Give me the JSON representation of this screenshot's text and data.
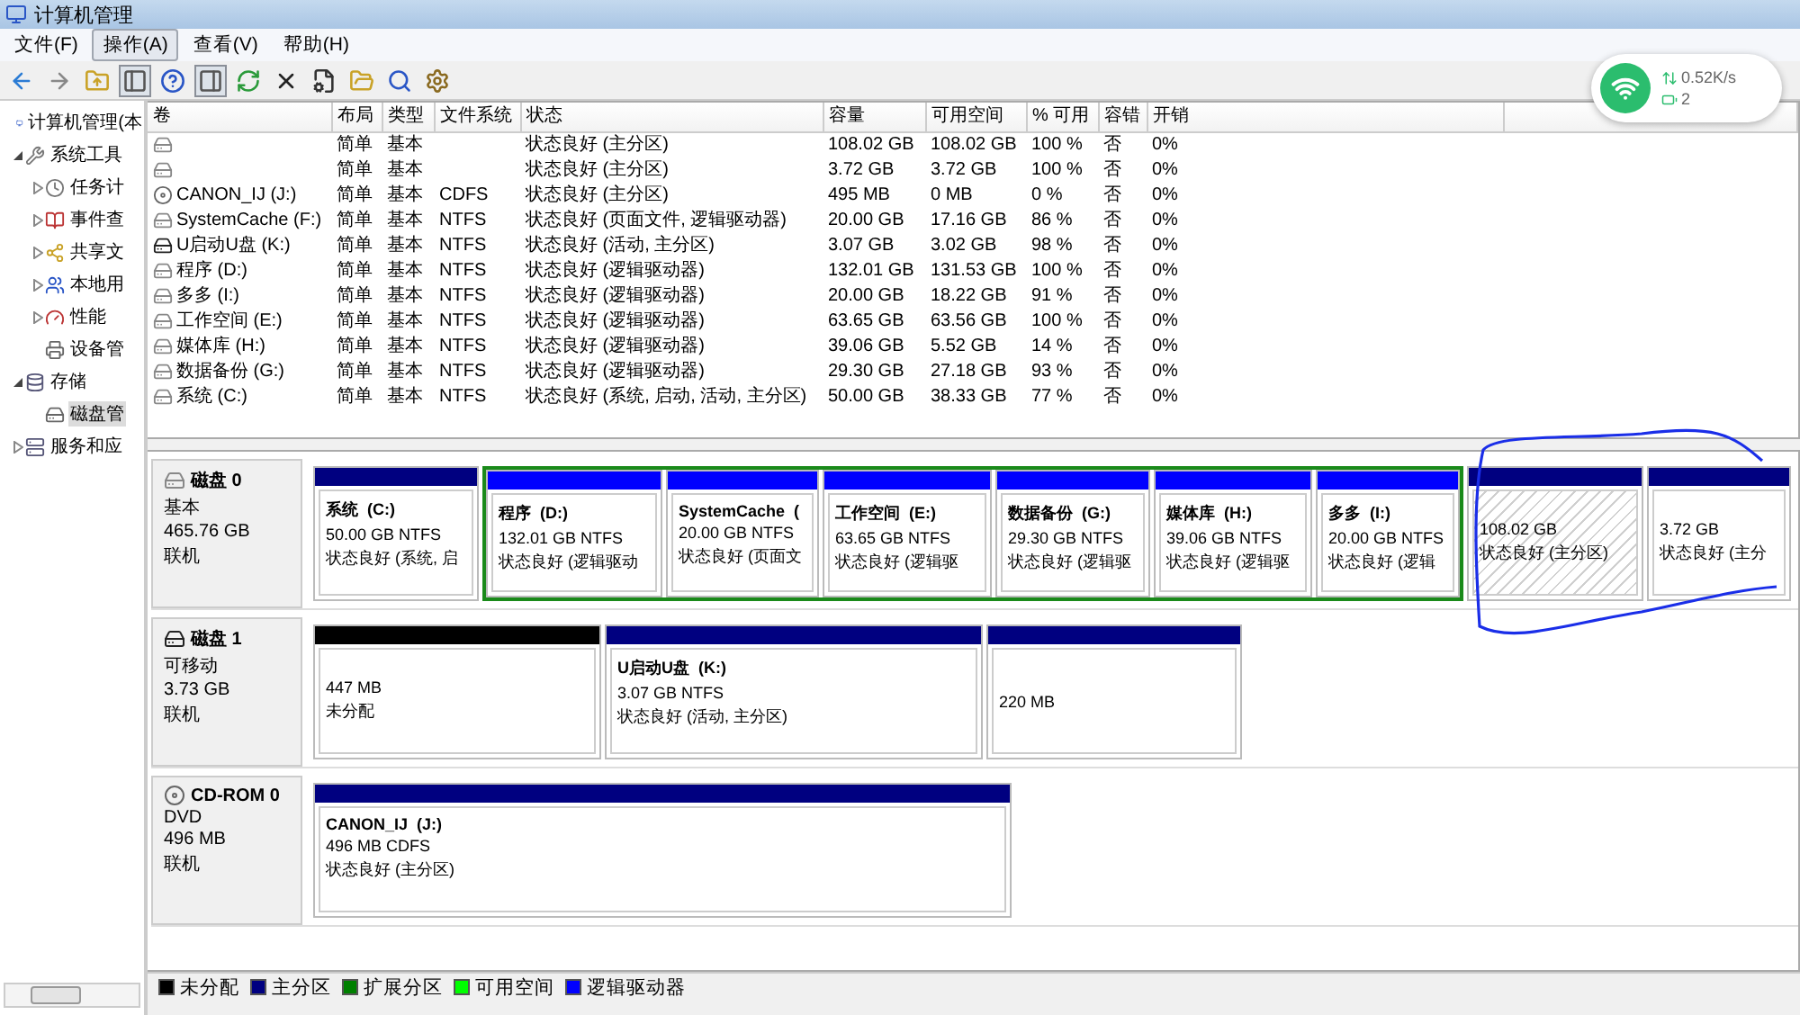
{
  "window": {
    "title": "计算机管理"
  },
  "menu": [
    {
      "label": "文件(F)",
      "selected": false
    },
    {
      "label": "操作(A)",
      "selected": true
    },
    {
      "label": "查看(V)",
      "selected": false
    },
    {
      "label": "帮助(H)",
      "selected": false
    }
  ],
  "toolbar": [
    {
      "kind": "back",
      "pressed": false
    },
    {
      "kind": "forward",
      "pressed": false
    },
    {
      "kind": "up",
      "pressed": false
    },
    {
      "kind": "tree",
      "pressed": true
    },
    {
      "kind": "help",
      "pressed": false
    },
    {
      "kind": "pane",
      "pressed": true
    },
    {
      "kind": "refresh",
      "pressed": false
    },
    {
      "kind": "delete",
      "pressed": false
    },
    {
      "kind": "properties",
      "pressed": false
    },
    {
      "kind": "open",
      "pressed": false
    },
    {
      "kind": "search",
      "pressed": false
    },
    {
      "kind": "settings",
      "pressed": false
    }
  ],
  "tree": [
    {
      "label": "计算机管理(本",
      "selected": false,
      "children": [
        {
          "label": "系统工具",
          "expanded": true,
          "selected": false,
          "children": [
            {
              "label": "任务计",
              "expanded": false,
              "selected": false
            },
            {
              "label": "事件查",
              "expanded": false,
              "selected": false
            },
            {
              "label": "共享文",
              "expanded": false,
              "selected": false
            },
            {
              "label": "本地用",
              "expanded": false,
              "selected": false
            },
            {
              "label": "性能",
              "expanded": false,
              "selected": false
            },
            {
              "label": "设备管",
              "selected": false
            }
          ]
        },
        {
          "label": "存储",
          "expanded": true,
          "selected": false,
          "children": [
            {
              "label": "磁盘管",
              "selected": true
            }
          ]
        },
        {
          "label": "服务和应",
          "expanded": false,
          "selected": false
        }
      ]
    }
  ],
  "table": {
    "columns": [
      "卷",
      "布局",
      "类型",
      "文件系统",
      "状态",
      "容量",
      "可用空间",
      "% 可用",
      "容错",
      "开销"
    ],
    "rows": [
      {
        "kind": "fixed",
        "cells": [
          "",
          "简单",
          "基本",
          "",
          "状态良好 (主分区)",
          "108.02 GB",
          "108.02 GB",
          "100 %",
          "否",
          "0%"
        ]
      },
      {
        "kind": "fixed",
        "cells": [
          "",
          "简单",
          "基本",
          "",
          "状态良好 (主分区)",
          "3.72 GB",
          "3.72 GB",
          "100 %",
          "否",
          "0%"
        ]
      },
      {
        "kind": "cd",
        "cells": [
          "CANON_IJ (J:)",
          "简单",
          "基本",
          "CDFS",
          "状态良好 (主分区)",
          "495 MB",
          "0 MB",
          "0 %",
          "否",
          "0%"
        ]
      },
      {
        "kind": "fixed",
        "cells": [
          "SystemCache (F:)",
          "简单",
          "基本",
          "NTFS",
          "状态良好 (页面文件, 逻辑驱动器)",
          "20.00 GB",
          "17.16 GB",
          "86 %",
          "否",
          "0%"
        ]
      },
      {
        "kind": "removable",
        "cells": [
          "U启动U盘 (K:)",
          "简单",
          "基本",
          "NTFS",
          "状态良好 (活动, 主分区)",
          "3.07 GB",
          "3.02 GB",
          "98 %",
          "否",
          "0%"
        ]
      },
      {
        "kind": "fixed",
        "cells": [
          "程序 (D:)",
          "简单",
          "基本",
          "NTFS",
          "状态良好 (逻辑驱动器)",
          "132.01 GB",
          "131.53 GB",
          "100 %",
          "否",
          "0%"
        ]
      },
      {
        "kind": "fixed",
        "cells": [
          "多多 (I:)",
          "简单",
          "基本",
          "NTFS",
          "状态良好 (逻辑驱动器)",
          "20.00 GB",
          "18.22 GB",
          "91 %",
          "否",
          "0%"
        ]
      },
      {
        "kind": "fixed",
        "cells": [
          "工作空间 (E:)",
          "简单",
          "基本",
          "NTFS",
          "状态良好 (逻辑驱动器)",
          "63.65 GB",
          "63.56 GB",
          "100 %",
          "否",
          "0%"
        ]
      },
      {
        "kind": "fixed",
        "cells": [
          "媒体库 (H:)",
          "简单",
          "基本",
          "NTFS",
          "状态良好 (逻辑驱动器)",
          "39.06 GB",
          "5.52 GB",
          "14 %",
          "否",
          "0%"
        ]
      },
      {
        "kind": "fixed",
        "cells": [
          "数据备份 (G:)",
          "简单",
          "基本",
          "NTFS",
          "状态良好 (逻辑驱动器)",
          "29.30 GB",
          "27.18 GB",
          "93 %",
          "否",
          "0%"
        ]
      },
      {
        "kind": "fixed",
        "cells": [
          "系统 (C:)",
          "简单",
          "基本",
          "NTFS",
          "状态良好 (系统, 启动, 活动, 主分区)",
          "50.00 GB",
          "38.33 GB",
          "77 %",
          "否",
          "0%"
        ]
      }
    ]
  },
  "disks": [
    {
      "kind": "fixed",
      "name": "磁盘 0",
      "type": "基本",
      "size": "465.76 GB",
      "state": "联机",
      "partitions": [
        {
          "kind": "primary",
          "selected": false,
          "name": "系统  (C:)",
          "size": "50.00 GB NTFS",
          "status": "状态良好 (系统, 启"
        },
        {
          "kind": "extended",
          "selected": false,
          "children": [
            {
              "kind": "logical",
              "selected": false,
              "name": "程序  (D:)",
              "size": "132.01 GB NTFS",
              "status": "状态良好 (逻辑驱动"
            },
            {
              "kind": "logical",
              "selected": false,
              "name": "SystemCache  (",
              "size": "20.00 GB NTFS",
              "status": "状态良好 (页面文"
            },
            {
              "kind": "logical",
              "selected": false,
              "name": "工作空间  (E:)",
              "size": "63.65 GB NTFS",
              "status": "状态良好 (逻辑驱"
            },
            {
              "kind": "logical",
              "selected": false,
              "name": "数据备份  (G:)",
              "size": "29.30 GB NTFS",
              "status": "状态良好 (逻辑驱"
            },
            {
              "kind": "logical",
              "selected": false,
              "name": "媒体库  (H:)",
              "size": "39.06 GB NTFS",
              "status": "状态良好 (逻辑驱"
            },
            {
              "kind": "logical",
              "selected": false,
              "name": "多多  (I:)",
              "size": "20.00 GB NTFS",
              "status": "状态良好 (逻辑"
            }
          ]
        },
        {
          "kind": "primary",
          "selected": true,
          "size": "108.02 GB",
          "status": "状态良好 (主分区)"
        },
        {
          "kind": "primary",
          "selected": false,
          "size": "3.72 GB",
          "status": "状态良好 (主分"
        }
      ]
    },
    {
      "kind": "removable",
      "name": "磁盘 1",
      "type": "可移动",
      "size": "3.73 GB",
      "state": "联机",
      "partitions": [
        {
          "kind": "unallocated",
          "selected": false,
          "size": "447 MB",
          "status": "未分配"
        },
        {
          "kind": "primary",
          "selected": false,
          "name": "U启动U盘  (K:)",
          "size": "3.07 GB NTFS",
          "status": "状态良好 (活动, 主分区)"
        },
        {
          "kind": "primary",
          "selected": false,
          "size": "220 MB"
        }
      ]
    },
    {
      "kind": "cd",
      "name": "CD-ROM 0",
      "type": "DVD",
      "size": "496 MB",
      "state": "联机",
      "partitions": [
        {
          "kind": "primary",
          "selected": false,
          "name": "CANON_IJ  (J:)",
          "size": "496 MB CDFS",
          "status": "状态良好 (主分区)"
        }
      ]
    }
  ],
  "legend": [
    {
      "label": "未分配",
      "color": "#000000"
    },
    {
      "label": "主分区",
      "color": "#000080"
    },
    {
      "label": "扩展分区",
      "color": "#008000"
    },
    {
      "label": "可用空间",
      "color": "#00ff00"
    },
    {
      "label": "逻辑驱动器",
      "color": "#0000ff"
    }
  ],
  "network_widget": {
    "speed": "0.52K/s",
    "count": "2"
  }
}
